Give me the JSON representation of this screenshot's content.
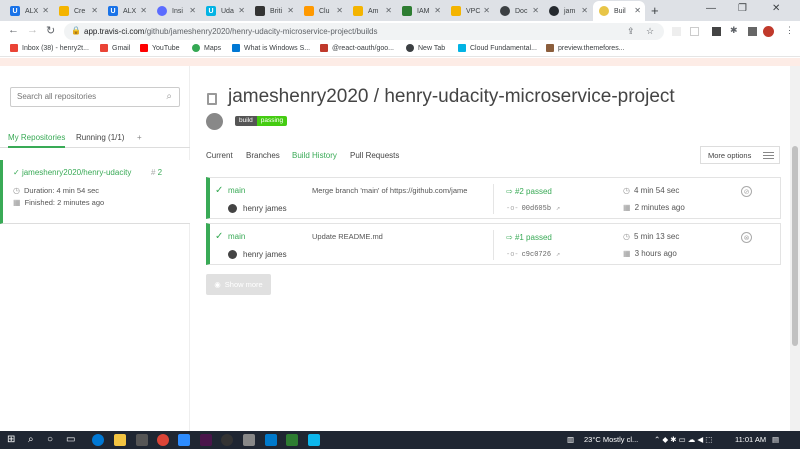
{
  "browser": {
    "tabs": [
      {
        "label": "ALX",
        "color": "#1a73e8"
      },
      {
        "label": "Cre",
        "color": "#f4b400"
      },
      {
        "label": "ALX",
        "color": "#1a73e8"
      },
      {
        "label": "Insi",
        "color": "#5b6cff"
      },
      {
        "label": "Uda",
        "color": "#02b3e4"
      },
      {
        "label": "Briti",
        "color": "#333333"
      },
      {
        "label": "Clu",
        "color": "#ff9900"
      },
      {
        "label": "Am",
        "color": "#f4b400"
      },
      {
        "label": "IAM",
        "color": "#2e7d32"
      },
      {
        "label": "VPC",
        "color": "#f4b400"
      },
      {
        "label": "Doc",
        "color": "#3c4043"
      },
      {
        "label": "jam",
        "color": "#24292e"
      },
      {
        "label": "Buil",
        "color": "#e8c547"
      }
    ],
    "url_host": "app.travis-ci.com",
    "url_path": "/github/jameshenry2020/henry-udacity-microservice-project/builds",
    "bookmarks": [
      {
        "label": "Inbox (38) - henry2t...",
        "color": "#ea4335"
      },
      {
        "label": "Gmail",
        "color": "#ea4335"
      },
      {
        "label": "YouTube",
        "color": "#ff0000"
      },
      {
        "label": "Maps",
        "color": "#34a853"
      },
      {
        "label": "What is Windows S...",
        "color": "#0078d4"
      },
      {
        "label": "@react-oauth/goo...",
        "color": "#c0392b"
      },
      {
        "label": "New Tab",
        "color": "#3c4043"
      },
      {
        "label": "Cloud Fundamental...",
        "color": "#02b3e4"
      },
      {
        "label": "preview.themefores...",
        "color": "#8b5e3c"
      }
    ]
  },
  "sidebar": {
    "search_placeholder": "Search all repositories",
    "tabs": [
      "My Repositories",
      "Running (1/1)",
      "+"
    ],
    "repo": {
      "name": "jameshenry2020/henry-udacity",
      "build_number": "2",
      "duration": "Duration: 4 min 54 sec",
      "finished": "Finished: 2 minutes ago"
    }
  },
  "main": {
    "title": "jameshenry2020 / henry-udacity-microservice-project",
    "badge_left": "build",
    "badge_right": "passing",
    "tabs": [
      "Current",
      "Branches",
      "Build History",
      "Pull Requests"
    ],
    "more_options": "More options",
    "builds": [
      {
        "branch": "main",
        "author": "henry james",
        "message": "Merge branch 'main' of https://github.com/jame",
        "status": "#2 passed",
        "commit": "00d605b",
        "duration": "4 min 54 sec",
        "finished": "2 minutes ago"
      },
      {
        "branch": "main",
        "author": "henry james",
        "message": "Update README.md",
        "status": "#1 passed",
        "commit": "c9c0726",
        "duration": "5 min 13 sec",
        "finished": "3 hours ago"
      }
    ],
    "show_more": "Show more"
  },
  "taskbar": {
    "weather": "23°C  Mostly cl...",
    "time": "11:01 AM"
  },
  "colors": {
    "travis_green": "#39aa56",
    "taskbar": "#1f2632"
  }
}
